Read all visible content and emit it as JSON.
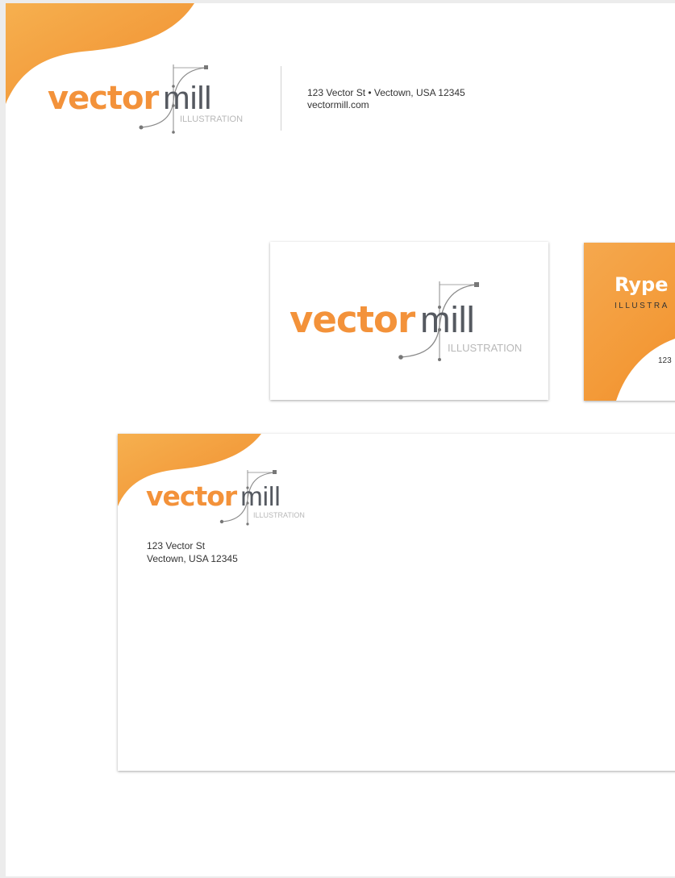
{
  "brand": {
    "word_vector": "vector",
    "word_mill": "mill",
    "tagline": "ILLUSTRATION",
    "orange": "#f3923a",
    "gray": "#555960"
  },
  "letterhead": {
    "address_line": "123 Vector St • Vectown, USA 12345",
    "website": "vectormill.com"
  },
  "back_card": {
    "name": "Rype",
    "title": "ILLUSTRA",
    "address_fragment": "123"
  },
  "envelope": {
    "address_line1": "123 Vector St",
    "address_line2": "Vectown, USA 12345"
  }
}
